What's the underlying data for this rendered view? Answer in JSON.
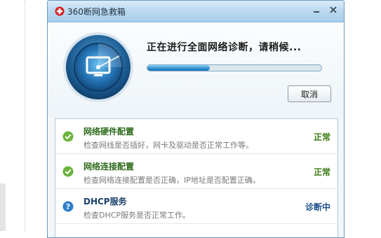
{
  "window": {
    "title": "360断网急救箱"
  },
  "header": {
    "status_text": "正在进行全面网络诊断，请稍候...",
    "progress_fraction": 0.36,
    "cancel_label": "取消"
  },
  "checks": [
    {
      "title": "网络硬件配置",
      "description": "检查网线是否插好，网卡及驱动是否正常工作等。",
      "status": "正常",
      "state": "ok"
    },
    {
      "title": "网络连接配置",
      "description": "检查网络连接配置是否正确，IP地址是否配置正确。",
      "status": "正常",
      "state": "ok"
    },
    {
      "title": "DHCP服务",
      "description": "检查DHCP服务是否正常工作。",
      "status": "诊断中",
      "state": "in-progress"
    }
  ],
  "colors": {
    "ok_green": "#6cb33f",
    "info_blue": "#2f7fcb",
    "accent_blue": "#2e8fd0"
  }
}
